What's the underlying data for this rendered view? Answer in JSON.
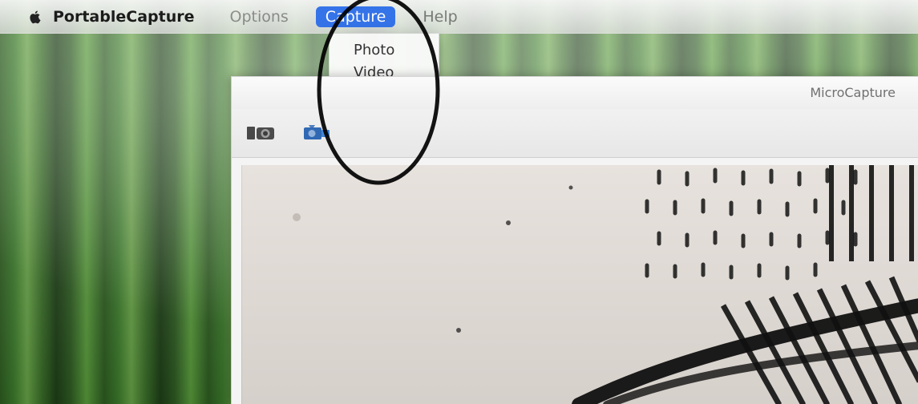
{
  "menubar": {
    "app_name": "PortableCapture",
    "items": [
      {
        "label": "Options"
      },
      {
        "label": "Capture"
      },
      {
        "label": "Help"
      }
    ]
  },
  "capture_menu": {
    "items": [
      {
        "label": "Photo"
      },
      {
        "label": "Video"
      }
    ]
  },
  "window": {
    "title": "MicroCapture"
  },
  "toolbar": {
    "buttons": [
      {
        "icon": "camera-icon"
      },
      {
        "icon": "video-camera-icon"
      }
    ]
  },
  "colors": {
    "menu_highlight": "#2f6de3"
  }
}
